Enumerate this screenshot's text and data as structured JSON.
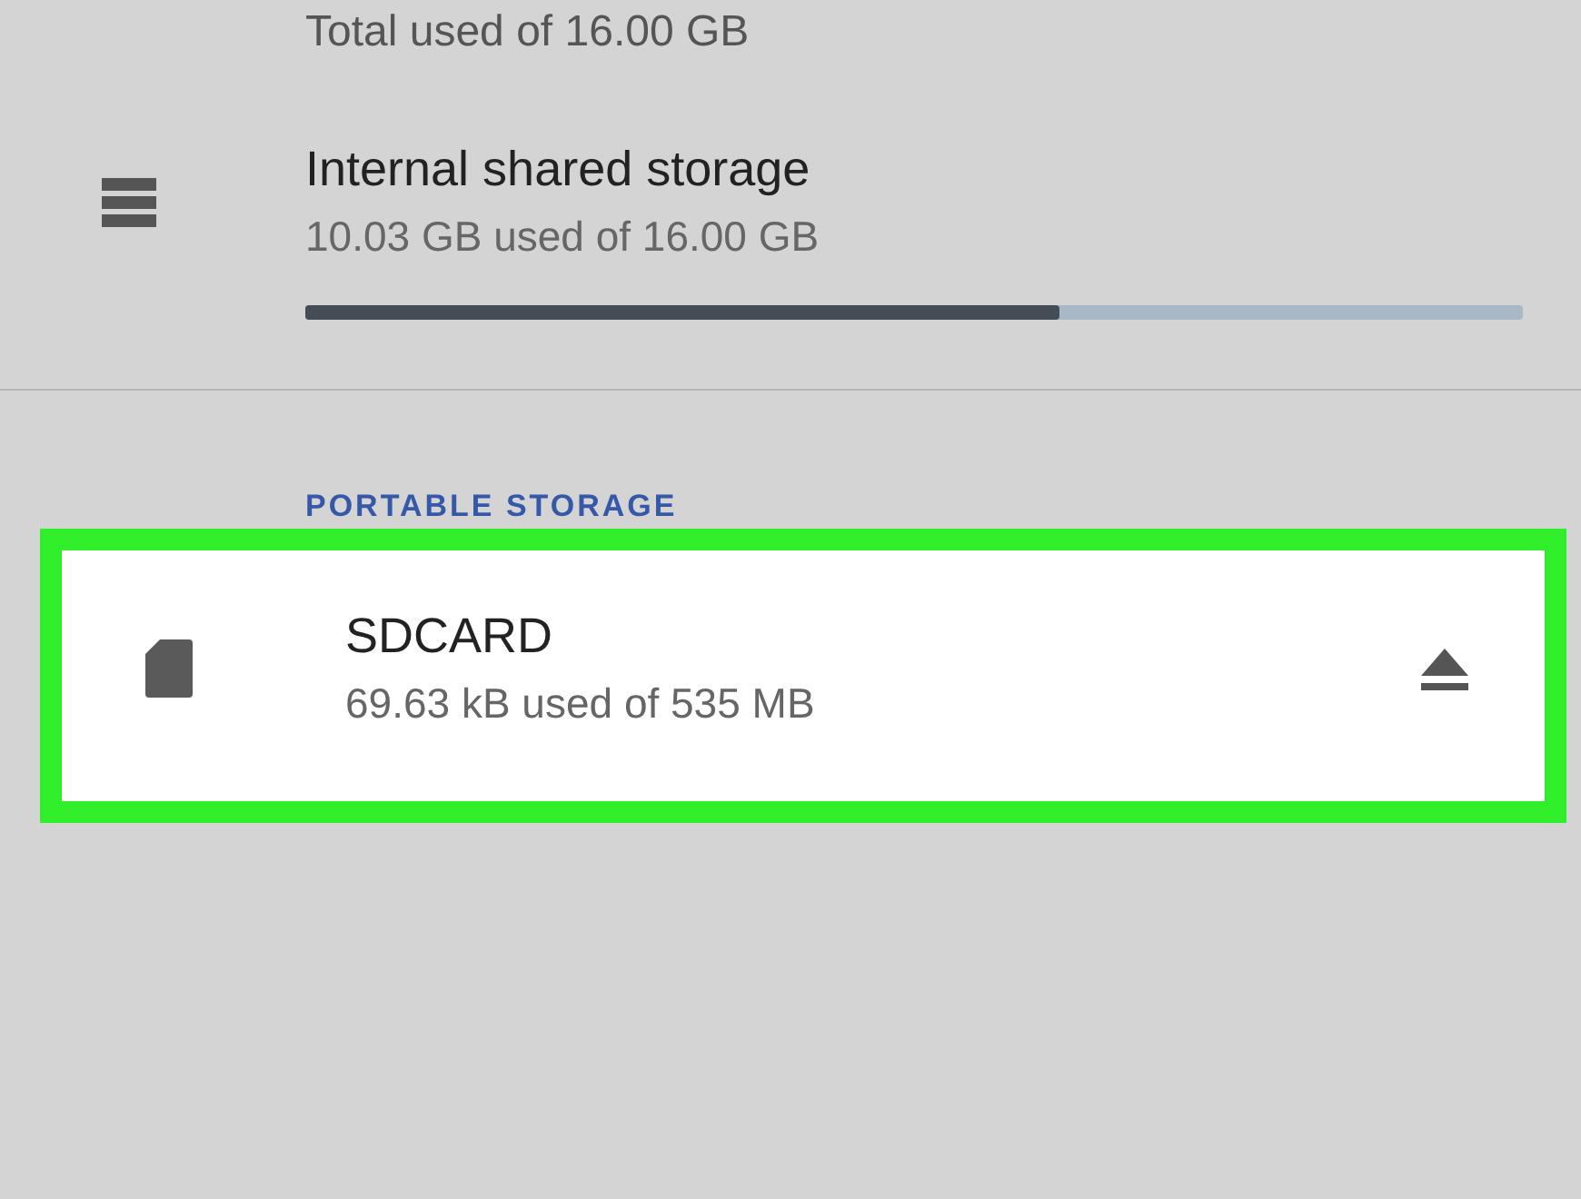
{
  "summary": {
    "text": "Total used of 16.00 GB"
  },
  "internal": {
    "title": "Internal shared storage",
    "subtitle": "10.03 GB used of 16.00 GB",
    "level": 0.62
  },
  "portable": {
    "header": "PORTABLE STORAGE",
    "items": [
      {
        "title": "SDCARD",
        "subtitle": "69.63 kB used of 535 MB",
        "highlighted": true
      }
    ]
  }
}
